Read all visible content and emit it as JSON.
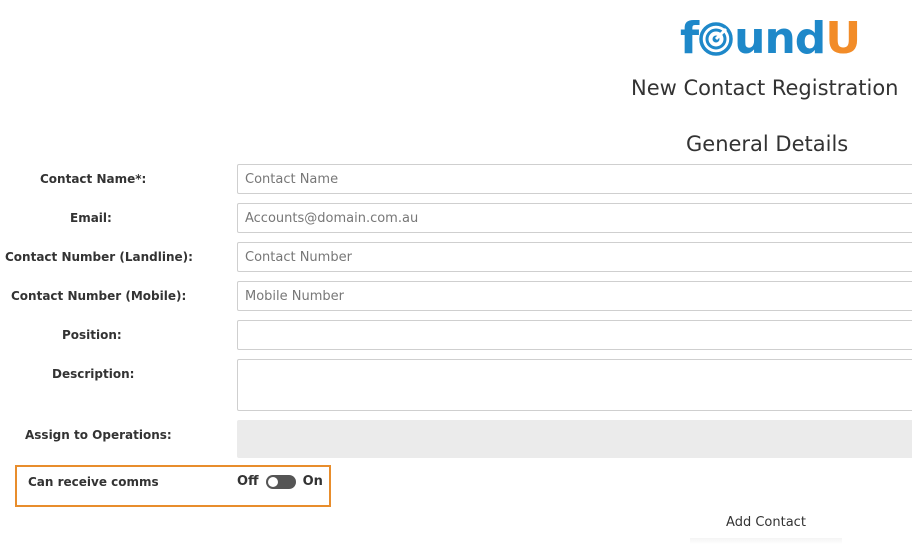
{
  "brand": {
    "logo_prefix": "f",
    "logo_middle": "und",
    "logo_suffix": "U",
    "colors": {
      "blue": "#1e88c9",
      "orange": "#f28c28"
    }
  },
  "page": {
    "title": "New Contact Registration",
    "section": "General Details"
  },
  "form": {
    "contact_name": {
      "label": "Contact Name*:",
      "placeholder": "Contact Name",
      "value": ""
    },
    "email": {
      "label": "Email:",
      "placeholder": "Accounts@domain.com.au",
      "value": ""
    },
    "landline": {
      "label": "Contact Number (Landline):",
      "placeholder": "Contact Number",
      "value": ""
    },
    "mobile": {
      "label": "Contact Number (Mobile):",
      "placeholder": "Mobile Number",
      "value": ""
    },
    "position": {
      "label": "Position:",
      "placeholder": "",
      "value": ""
    },
    "description": {
      "label": "Description:",
      "placeholder": "",
      "value": ""
    },
    "operations": {
      "label": "Assign to Operations:",
      "value": ""
    },
    "comms": {
      "label": "Can receive comms",
      "off_label": "Off",
      "on_label": "On",
      "state": "off",
      "highlight_color": "#e88d2c"
    }
  },
  "actions": {
    "add_contact": "Add Contact"
  }
}
